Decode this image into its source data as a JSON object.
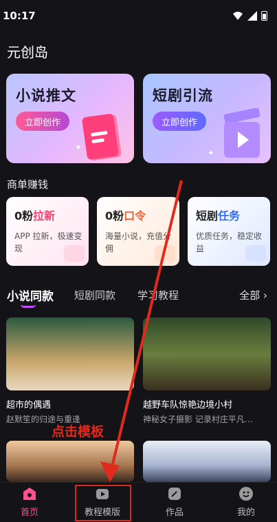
{
  "status_bar": {
    "time": "10:17"
  },
  "app": {
    "title": "元创岛"
  },
  "hero_cards": [
    {
      "title": "小说推文",
      "button": "立即创作"
    },
    {
      "title": "短剧引流",
      "button": "立即创作"
    }
  ],
  "earn_section": {
    "label": "商单赚钱",
    "cards": [
      {
        "prefix": "0粉",
        "highlight": "拉新",
        "desc": "APP 拉新，极速变现",
        "accent": "#ff3c6e"
      },
      {
        "prefix": "0粉",
        "highlight": "口令",
        "desc": "海量小说，充值分佣",
        "accent": "#ff5a2a"
      },
      {
        "prefix": "短剧",
        "highlight": "任务",
        "desc": "优质任务，稳定收益",
        "accent": "#2f6dff"
      }
    ]
  },
  "tabs": {
    "items": [
      "小说同款",
      "短剧同款",
      "学习教程"
    ],
    "all": "全部 ›"
  },
  "content_cards": [
    {
      "title": "超市的偶遇",
      "sub": "赵默笙的归途与重逢"
    },
    {
      "title": "越野车队惊艳边境小村",
      "sub": "神秘女子摄影 记录村庄平凡…"
    },
    {
      "title": "",
      "sub": ""
    },
    {
      "title": "",
      "sub": ""
    }
  ],
  "annotation": {
    "text": "点击模板",
    "color": "#e02a1e"
  },
  "bottom_nav": [
    {
      "label": "首页",
      "icon": "home-icon"
    },
    {
      "label": "教程模版",
      "icon": "play-icon"
    },
    {
      "label": "作品",
      "icon": "edit-icon"
    },
    {
      "label": "我的",
      "icon": "smile-icon"
    }
  ]
}
